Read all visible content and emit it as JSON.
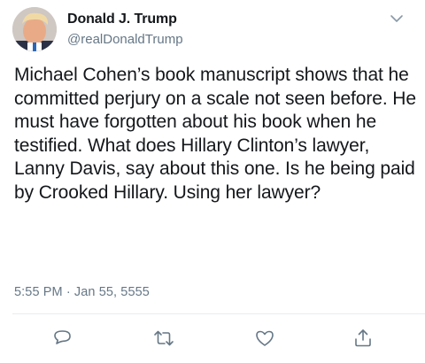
{
  "tweet": {
    "display_name": "Donald J. Trump",
    "handle": "@realDonaldTrump",
    "text": "Michael Cohen’s book manuscript shows that he committed perjury on a scale not seen before. He must have forgotten about his book when he testified. What does Hillary Clinton’s lawyer, Lanny Davis, say about this one. Is he being paid by Crooked Hillary. Using her lawyer?",
    "timestamp": "5:55 PM · Jan 55, 5555"
  },
  "icons": {
    "menu": "chevron-down-icon",
    "reply": "reply-icon",
    "retweet": "retweet-icon",
    "like": "heart-icon",
    "share": "share-icon"
  },
  "colors": {
    "text": "#14171a",
    "secondary": "#657786",
    "icon": "#657786",
    "divider": "#e6ecf0"
  }
}
